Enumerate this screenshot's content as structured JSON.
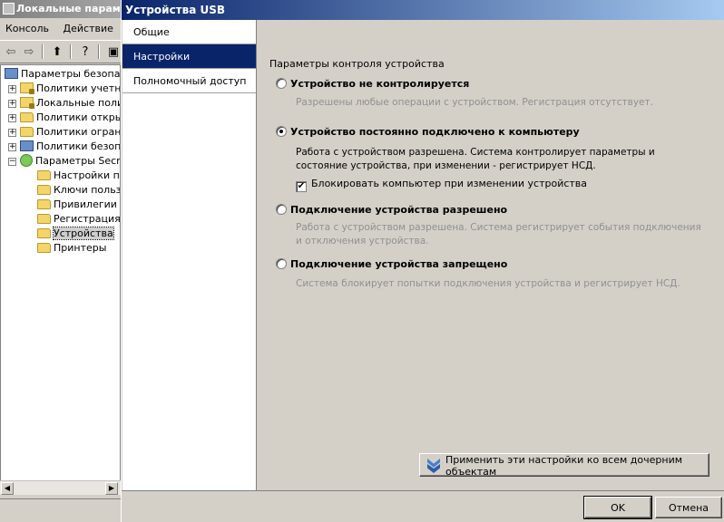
{
  "background_window": {
    "title": "Локальные параметры",
    "menu": [
      "Консоль",
      "Действие"
    ],
    "tree": [
      {
        "label": "Параметры безопасности",
        "icon": "computer-icon",
        "level": 0
      },
      {
        "label": "Политики учетных записей",
        "icon": "lock-folder-icon",
        "level": 1,
        "expander": "+"
      },
      {
        "label": "Локальные политики",
        "icon": "lock-folder-icon",
        "level": 1,
        "expander": "+"
      },
      {
        "label": "Политики открытого ключа",
        "icon": "folder-icon",
        "level": 1,
        "expander": "+"
      },
      {
        "label": "Политики ограниченного использования",
        "icon": "folder-icon",
        "level": 1,
        "expander": "+"
      },
      {
        "label": "Политики безопасности IP",
        "icon": "computer-icon",
        "level": 1,
        "expander": "+"
      },
      {
        "label": "Параметры Secret Net",
        "icon": "green-icon",
        "level": 1,
        "expander": "−"
      },
      {
        "label": "Настройки подсистем",
        "icon": "folder-icon",
        "level": 2
      },
      {
        "label": "Ключи пользователей",
        "icon": "folder-icon",
        "level": 2
      },
      {
        "label": "Привилегии",
        "icon": "folder-icon",
        "level": 2
      },
      {
        "label": "Регистрация событий",
        "icon": "folder-icon",
        "level": 2
      },
      {
        "label": "Устройства",
        "icon": "folder-icon",
        "level": 2,
        "selected": true
      },
      {
        "label": "Принтеры",
        "icon": "folder-icon",
        "level": 2
      }
    ]
  },
  "dialog": {
    "title": "Устройства USB",
    "nav": [
      {
        "label": "Общие",
        "active": false
      },
      {
        "label": "Настройки",
        "active": true
      },
      {
        "label": "Полномочный доступ",
        "active": false
      }
    ],
    "section_title": "Параметры контроля устройства",
    "options": [
      {
        "label": "Устройство не контролируется",
        "checked": false,
        "description": "Разрешены любые операции с устройством. Регистрация отсутствует.",
        "enabled": false
      },
      {
        "label": "Устройство постоянно подключено к компьютеру",
        "checked": true,
        "description": "Работа с устройством разрешена. Система контролирует параметры и состояние устройства, при изменении - регистрирует НСД.",
        "enabled": true
      },
      {
        "label": "Подключение устройства разрешено",
        "checked": false,
        "description": "Работа с устройством разрешена. Система регистрирует события подключения и отключения устройства.",
        "enabled": false
      },
      {
        "label": "Подключение устройства запрещено",
        "checked": false,
        "description": "Система блокирует попытки подключения устройства и регистрирует НСД.",
        "enabled": false
      }
    ],
    "lock_checkbox": {
      "label": "Блокировать компьютер при изменении устройства",
      "checked": true,
      "check_glyph": "✔"
    },
    "apply_button": "Применить эти настройки ко всем дочерним объектам",
    "ok_button": "OK",
    "cancel_button": "Отмена"
  }
}
